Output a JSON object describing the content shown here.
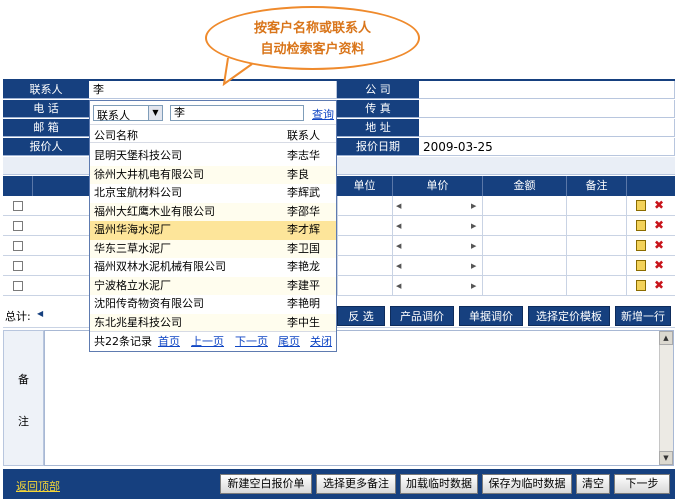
{
  "callout": {
    "line1": "按客户名称或联系人",
    "line2": "自动检索客户资料"
  },
  "form": {
    "contact_label": "联系人",
    "contact_value": "李",
    "phone_label": "电 话",
    "post_label": "邮 箱",
    "quoter_label": "报价人",
    "company_label": "公 司",
    "fax_label": "传 真",
    "address_label": "地 址",
    "quote_date_label": "报价日期",
    "quote_date_value": "2009-03-25"
  },
  "popup": {
    "filter_select": "联系人",
    "search_value": "李",
    "search_link": "查询",
    "col_company": "公司名称",
    "col_contact": "联系人",
    "items": [
      {
        "company": "昆明天堡科技公司",
        "contact": "李志华"
      },
      {
        "company": "徐州大井机电有限公司",
        "contact": "李良"
      },
      {
        "company": "北京宝航材料公司",
        "contact": "李辉武"
      },
      {
        "company": "福州大红鹰木业有限公司",
        "contact": "李邵华"
      },
      {
        "company": "温州华海水泥厂",
        "contact": "李才辉"
      },
      {
        "company": "华东三草水泥厂",
        "contact": "李卫国"
      },
      {
        "company": "福州双林水泥机械有限公司",
        "contact": "李艳龙"
      },
      {
        "company": "宁波格立水泥厂",
        "contact": "李建平"
      },
      {
        "company": "沈阳传奇物资有限公司",
        "contact": "李艳明"
      },
      {
        "company": "东北兆星科技公司",
        "contact": "李中生"
      }
    ],
    "footer": {
      "count": "共22条记录",
      "first": "首页",
      "prev": "上一页",
      "next": "下一页",
      "last": "尾页",
      "close": "关闭"
    }
  },
  "table": {
    "headers": {
      "unit": "单位",
      "price": "单价",
      "amount": "金额",
      "remark": "备注"
    },
    "row_count": 5,
    "total_label": "总计:"
  },
  "action_buttons": {
    "invert": "反 选",
    "product_price": "产品调价",
    "doc_price": "单据调价",
    "template": "选择定价模板",
    "add_row": "新增一行"
  },
  "remark": {
    "label_1": "备",
    "label_2": "注"
  },
  "bottom": {
    "back_top": "返回顶部",
    "new_blank": "新建空白报价单",
    "more_remark": "选择更多备注",
    "load_temp": "加载临时数据",
    "save_temp": "保存为临时数据",
    "clear": "清空",
    "next_step": "下一步"
  },
  "colors": {
    "navy": "#16407f",
    "accent_orange": "#ef8a2c",
    "highlight": "#fde59a",
    "link": "#1046c4"
  }
}
